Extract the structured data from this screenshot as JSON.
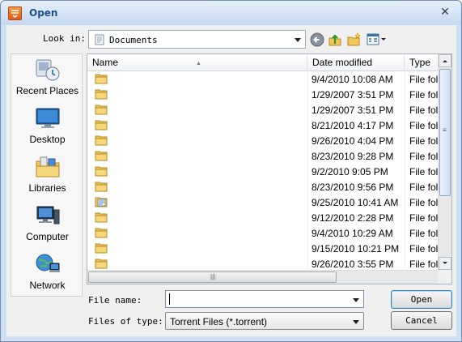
{
  "window": {
    "title": "Open"
  },
  "toolbar": {
    "look_in_label": "Look in:",
    "look_in_value": "Documents",
    "icons": [
      "back-icon",
      "up-folder-icon",
      "new-folder-icon",
      "view-menu-icon"
    ]
  },
  "places": [
    {
      "label": "Recent Places",
      "icon": "recent-places-icon"
    },
    {
      "label": "Desktop",
      "icon": "desktop-icon"
    },
    {
      "label": "Libraries",
      "icon": "libraries-icon"
    },
    {
      "label": "Computer",
      "icon": "computer-icon"
    },
    {
      "label": "Network",
      "icon": "network-icon"
    }
  ],
  "file_list": {
    "columns": [
      "Name",
      "Date modified",
      "Type"
    ],
    "sort_column": "Name",
    "rows": [
      {
        "name": "",
        "date": "9/4/2010 10:08 AM",
        "type": "File folder",
        "icon": "folder-icon"
      },
      {
        "name": "",
        "date": "1/29/2007 3:51 PM",
        "type": "File folder",
        "icon": "folder-icon"
      },
      {
        "name": "",
        "date": "1/29/2007 3:51 PM",
        "type": "File folder",
        "icon": "folder-icon"
      },
      {
        "name": "",
        "date": "8/21/2010 4:17 PM",
        "type": "File folder",
        "icon": "folder-icon"
      },
      {
        "name": "",
        "date": "9/26/2010 4:04 PM",
        "type": "File folder",
        "icon": "folder-icon"
      },
      {
        "name": "",
        "date": "8/23/2010 9:28 PM",
        "type": "File folder",
        "icon": "folder-icon"
      },
      {
        "name": "",
        "date": "9/2/2010 9:05 PM",
        "type": "File folder",
        "icon": "folder-icon"
      },
      {
        "name": "",
        "date": "8/23/2010 9:56 PM",
        "type": "File folder",
        "icon": "folder-icon"
      },
      {
        "name": "",
        "date": "9/25/2010 10:41 AM",
        "type": "File folder",
        "icon": "special-folder-icon"
      },
      {
        "name": "",
        "date": "9/12/2010 2:28 PM",
        "type": "File folder",
        "icon": "folder-icon"
      },
      {
        "name": "",
        "date": "9/4/2010 10:29 AM",
        "type": "File folder",
        "icon": "folder-icon"
      },
      {
        "name": "",
        "date": "9/15/2010 10:21 PM",
        "type": "File folder",
        "icon": "folder-icon"
      },
      {
        "name": "",
        "date": "9/26/2010 3:55 PM",
        "type": "File folder",
        "icon": "folder-icon"
      }
    ]
  },
  "form": {
    "file_name_label": "File name:",
    "file_name_value": "",
    "file_type_label": "Files of type:",
    "file_type_value": "Torrent Files (*.torrent)"
  },
  "buttons": {
    "open": "Open",
    "cancel": "Cancel"
  }
}
